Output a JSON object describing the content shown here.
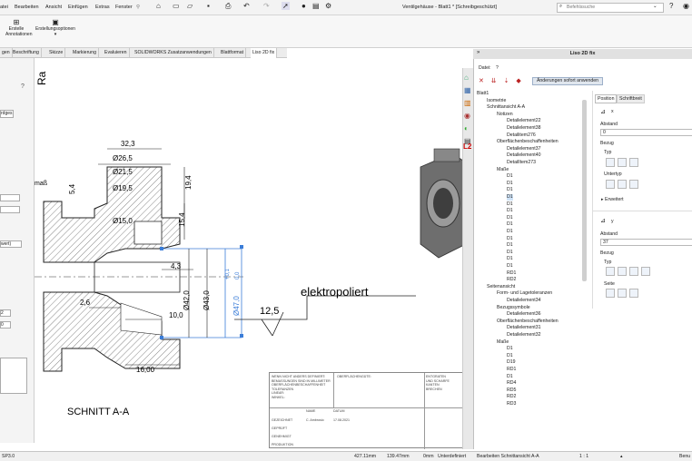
{
  "menu": [
    "atei",
    "Bearbeiten",
    "Ansicht",
    "Einfügen",
    "Extras",
    "Fenster"
  ],
  "window_title": "Ventilgehäuse - Blatt1 * [Schreibgeschützt]",
  "search_placeholder": "Befehlssuche",
  "ribbon": {
    "btn1_line1": "Erstelle",
    "btn1_line2": "Annotationen",
    "btn2": "Erstellungsoptionen"
  },
  "tabs": [
    "gen",
    "Beschriftung",
    "Skizze",
    "Markierung",
    "Evaluieren",
    "SOLIDWORKS Zusatzanwendungen",
    "Blattformat",
    "Liso 2D fix"
  ],
  "left": {
    "gruppe": "rdges",
    "num1": "2",
    "num2": "0",
    "sel": "wert)"
  },
  "drawing": {
    "dims": [
      "32,3",
      "Ø26,5",
      "Ø21,5",
      "Ø19,5",
      "Ø15,0",
      "19,4",
      "15,4",
      "5,4",
      "4,3",
      "2,6",
      "10,0",
      "16,00",
      "Ø42,0",
      "Ø43,0",
      "Ø47,0",
      "0,0",
      "+0,1",
      "12,5"
    ],
    "note": "elektropoliert",
    "section_label": "SCHNITT A-A",
    "corner_label": "Ra",
    "mass_label": "maß"
  },
  "titleblock": {
    "general": "WENN NICHT ANDERS DEFINIERT:\nBEMASSUNGEN SIND IN MILLIMETER\nOBERFLÄCHENBESCHAFFENHEIT\nTOLERANZEN\nLINEAR:\nWINKEL:",
    "finish": "OBERFLÄCHENGÜTE:",
    "deburr": "ENTGRATEN\nUND SCHARFE\nKANTEN\nBRECHEN",
    "name": "NAME",
    "datum": "DATUM",
    "rows": [
      "GEZEICHNET",
      "GEPRÜFT",
      "GENEHMIGT",
      "PRODUKTION"
    ],
    "drawn_by": "C. Ambrosio",
    "drawn_date": "17.08.2021",
    "bem": "BEM"
  },
  "panel": {
    "title": "Liso 2D fix",
    "datei_label": "Datei:",
    "datei_value": "?",
    "apply_button": "Änderungen sofort anwenden",
    "tree": [
      {
        "t": "Blatt1",
        "d": 0
      },
      {
        "t": "Isometrie",
        "d": 1
      },
      {
        "t": "Schnittansicht A-A",
        "d": 1
      },
      {
        "t": "Notizen",
        "d": 2
      },
      {
        "t": "Detailelement22",
        "d": 3
      },
      {
        "t": "Detailelement38",
        "d": 3
      },
      {
        "t": "Detailitem276",
        "d": 3
      },
      {
        "t": "Oberflächenbeschaffenheiten",
        "d": 2
      },
      {
        "t": "Detailelement37",
        "d": 3
      },
      {
        "t": "Detailelement40",
        "d": 3
      },
      {
        "t": "DetailItem273",
        "d": 3
      },
      {
        "t": "Maße",
        "d": 2
      },
      {
        "t": "D1",
        "d": 3
      },
      {
        "t": "D1",
        "d": 3
      },
      {
        "t": "D1",
        "d": 3
      },
      {
        "t": "D1",
        "d": 3,
        "sel": true
      },
      {
        "t": "D1",
        "d": 3
      },
      {
        "t": "D1",
        "d": 3
      },
      {
        "t": "D1",
        "d": 3
      },
      {
        "t": "D1",
        "d": 3
      },
      {
        "t": "D1",
        "d": 3
      },
      {
        "t": "D1",
        "d": 3
      },
      {
        "t": "D1",
        "d": 3
      },
      {
        "t": "D1",
        "d": 3
      },
      {
        "t": "D1",
        "d": 3
      },
      {
        "t": "D1",
        "d": 3
      },
      {
        "t": "RD1",
        "d": 3
      },
      {
        "t": "RD2",
        "d": 3
      },
      {
        "t": "Seitenansicht",
        "d": 1
      },
      {
        "t": "Form- und Lagetoleranzen",
        "d": 2
      },
      {
        "t": "Detailelement34",
        "d": 3
      },
      {
        "t": "Bezugssymbole",
        "d": 2
      },
      {
        "t": "Detailelement36",
        "d": 3
      },
      {
        "t": "Oberflächenbeschaffenheiten",
        "d": 2
      },
      {
        "t": "Detailelement31",
        "d": 3
      },
      {
        "t": "Detailelement32",
        "d": 3
      },
      {
        "t": "Maße",
        "d": 2
      },
      {
        "t": "D1",
        "d": 3
      },
      {
        "t": "D1",
        "d": 3
      },
      {
        "t": "D19",
        "d": 3
      },
      {
        "t": "RD1",
        "d": 3
      },
      {
        "t": "D1",
        "d": 3
      },
      {
        "t": "RD4",
        "d": 3
      },
      {
        "t": "RD5",
        "d": 3
      },
      {
        "t": "RD2",
        "d": 3
      },
      {
        "t": "RD3",
        "d": 3
      }
    ],
    "prop_tabs": [
      "Position",
      "Schriftbreit"
    ],
    "x_label": "x",
    "abstand": "Abstand",
    "x_value": "0",
    "bezug": "Bezug",
    "typ": "Typ",
    "untertyp": "Untertyp",
    "erweitert": "Erweitert",
    "y_label": "y",
    "y_value": "37",
    "seite": "Seite"
  },
  "status": {
    "left": "SP3.0",
    "x": "427.11mm",
    "y": "139.47mm",
    "z": "0mm",
    "state": "Unterdefiniert",
    "edit": "Bearbeiten Schnittansicht A-A",
    "scale": "1 : 1",
    "right": "Benu"
  }
}
